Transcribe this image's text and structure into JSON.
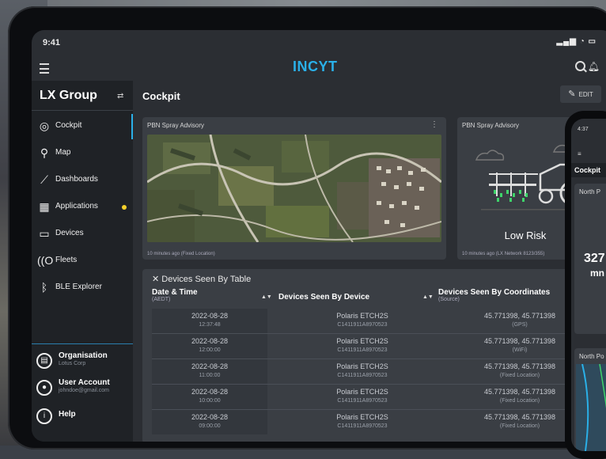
{
  "status": {
    "time": "9:41",
    "indicators": "▂▄▆ ◔ ▭"
  },
  "app": {
    "logo": "INCYT",
    "accent": "#2ab0e8"
  },
  "sidebar": {
    "group": "LX Group",
    "items": [
      {
        "label": "Cockpit",
        "icon": "cockpit-icon"
      },
      {
        "label": "Map",
        "icon": "map-pin-icon"
      },
      {
        "label": "Dashboards",
        "icon": "chart-line-icon"
      },
      {
        "label": "Applications",
        "icon": "grid-icon",
        "badge": true
      },
      {
        "label": "Devices",
        "icon": "devices-icon"
      },
      {
        "label": "Fleets",
        "icon": "fleets-icon"
      },
      {
        "label": "BLE Explorer",
        "icon": "bluetooth-icon"
      }
    ],
    "account": [
      {
        "title": "Organisation",
        "sub": "Lotus Corp",
        "icon": "org-icon"
      },
      {
        "title": "User Account",
        "sub": "johndoe@gmail.com",
        "icon": "user-icon"
      },
      {
        "title": "Help",
        "sub": "",
        "icon": "help-icon"
      }
    ]
  },
  "main": {
    "title": "Cockpit",
    "edit_label": "EDIT",
    "card1": {
      "title": "PBN Spray Advisory",
      "footer": "10 minutes ago (Fixed Location)"
    },
    "card2": {
      "title": "PBN Spray Advisory",
      "risk": "Low Risk",
      "footer": "10 minutes ago (LX Network 8123/355)"
    },
    "table": {
      "title": "Devices Seen By Table",
      "headers": [
        {
          "label": "Date & Time",
          "sub": "(AEDT)"
        },
        {
          "label": "Devices Seen By Device",
          "sub": ""
        },
        {
          "label": "Devices Seen By Coordinates",
          "sub": "(Source)"
        }
      ],
      "rows": [
        {
          "date": "2022-08-28",
          "time": "12:37:48",
          "device": "Polaris ETCH2S",
          "id": "C1411911A8970523",
          "coords": "45.771398, 45.771398",
          "source": "(GPS)"
        },
        {
          "date": "2022-08-28",
          "time": "12:00:00",
          "device": "Polaris ETCH2S",
          "id": "C1411911A8970523",
          "coords": "45.771398, 45.771398",
          "source": "(WiFi)"
        },
        {
          "date": "2022-08-28",
          "time": "11:00:00",
          "device": "Polaris ETCH2S",
          "id": "C1411911A8970523",
          "coords": "45.771398, 45.771398",
          "source": "(Fixed Location)"
        },
        {
          "date": "2022-08-28",
          "time": "10:00:00",
          "device": "Polaris ETCH2S",
          "id": "C1411911A8970523",
          "coords": "45.771398, 45.771398",
          "source": "(Fixed Location)"
        },
        {
          "date": "2022-08-28",
          "time": "09:00:00",
          "device": "Polaris ETCH2S",
          "id": "C1411911A8970523",
          "coords": "45.771398, 45.771398",
          "source": "(Fixed Location)"
        }
      ]
    }
  },
  "phone": {
    "time": "4:37",
    "title": "Cockpit",
    "card1": "North P",
    "value": "327",
    "unit": "mn",
    "card2": "North Po"
  }
}
